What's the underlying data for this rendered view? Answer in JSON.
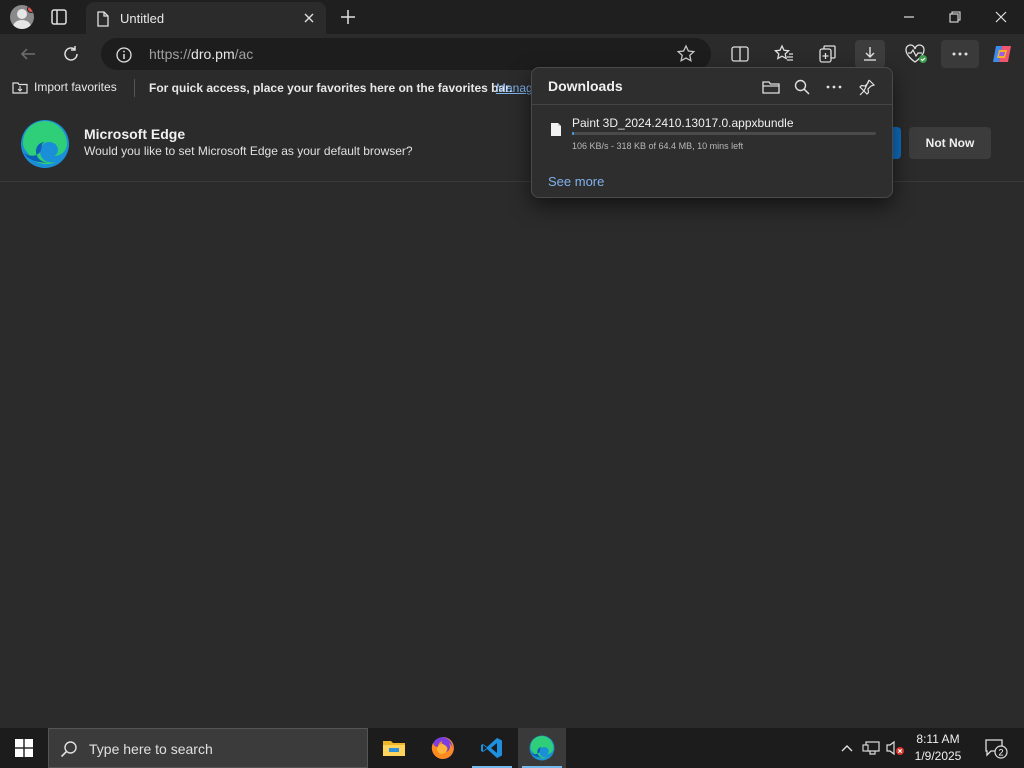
{
  "tab": {
    "title": "Untitled"
  },
  "address": {
    "scheme": "https://",
    "host": "dro.pm",
    "path": "/ac"
  },
  "favorites_bar": {
    "import_label": "Import favorites",
    "message": "For quick access, place your favorites here on the favorites bar.",
    "manage_link": "Manage favorites now"
  },
  "infobar": {
    "product": "Microsoft Edge",
    "question": "Would you like to set Microsoft Edge as your default browser?",
    "not_now": "Not Now"
  },
  "downloads": {
    "title": "Downloads",
    "item": {
      "filename": "Paint 3D_2024.2410.13017.0.appxbundle",
      "status": "106 KB/s - 318 KB of 64.4 MB, 10 mins left",
      "progress_fraction": 0.005
    },
    "see_more": "See more"
  },
  "taskbar": {
    "search_placeholder": "Type here to search",
    "time": "8:11 AM",
    "date": "1/9/2025",
    "notification_count": "2"
  },
  "icons": [
    "profile-icon",
    "tab-actions-icon",
    "document-icon",
    "close-icon",
    "plus-icon",
    "minimize-icon",
    "restore-icon",
    "back-icon",
    "refresh-icon",
    "info-icon",
    "star-icon",
    "split-screen-icon",
    "favorites-icon",
    "collections-icon",
    "download-icon",
    "browser-essentials-icon",
    "more-icon",
    "copilot-icon",
    "folder-icon",
    "search-icon",
    "pin-icon",
    "windows-logo-icon",
    "file-explorer-icon",
    "firefox-icon",
    "vscode-icon",
    "edge-icon",
    "chevron-up-icon",
    "network-icon",
    "volume-muted-icon",
    "notification-icon"
  ],
  "colors": {
    "accent": "#0f6cbd",
    "link": "#7fb2ee",
    "background": "#2b2b2b"
  }
}
